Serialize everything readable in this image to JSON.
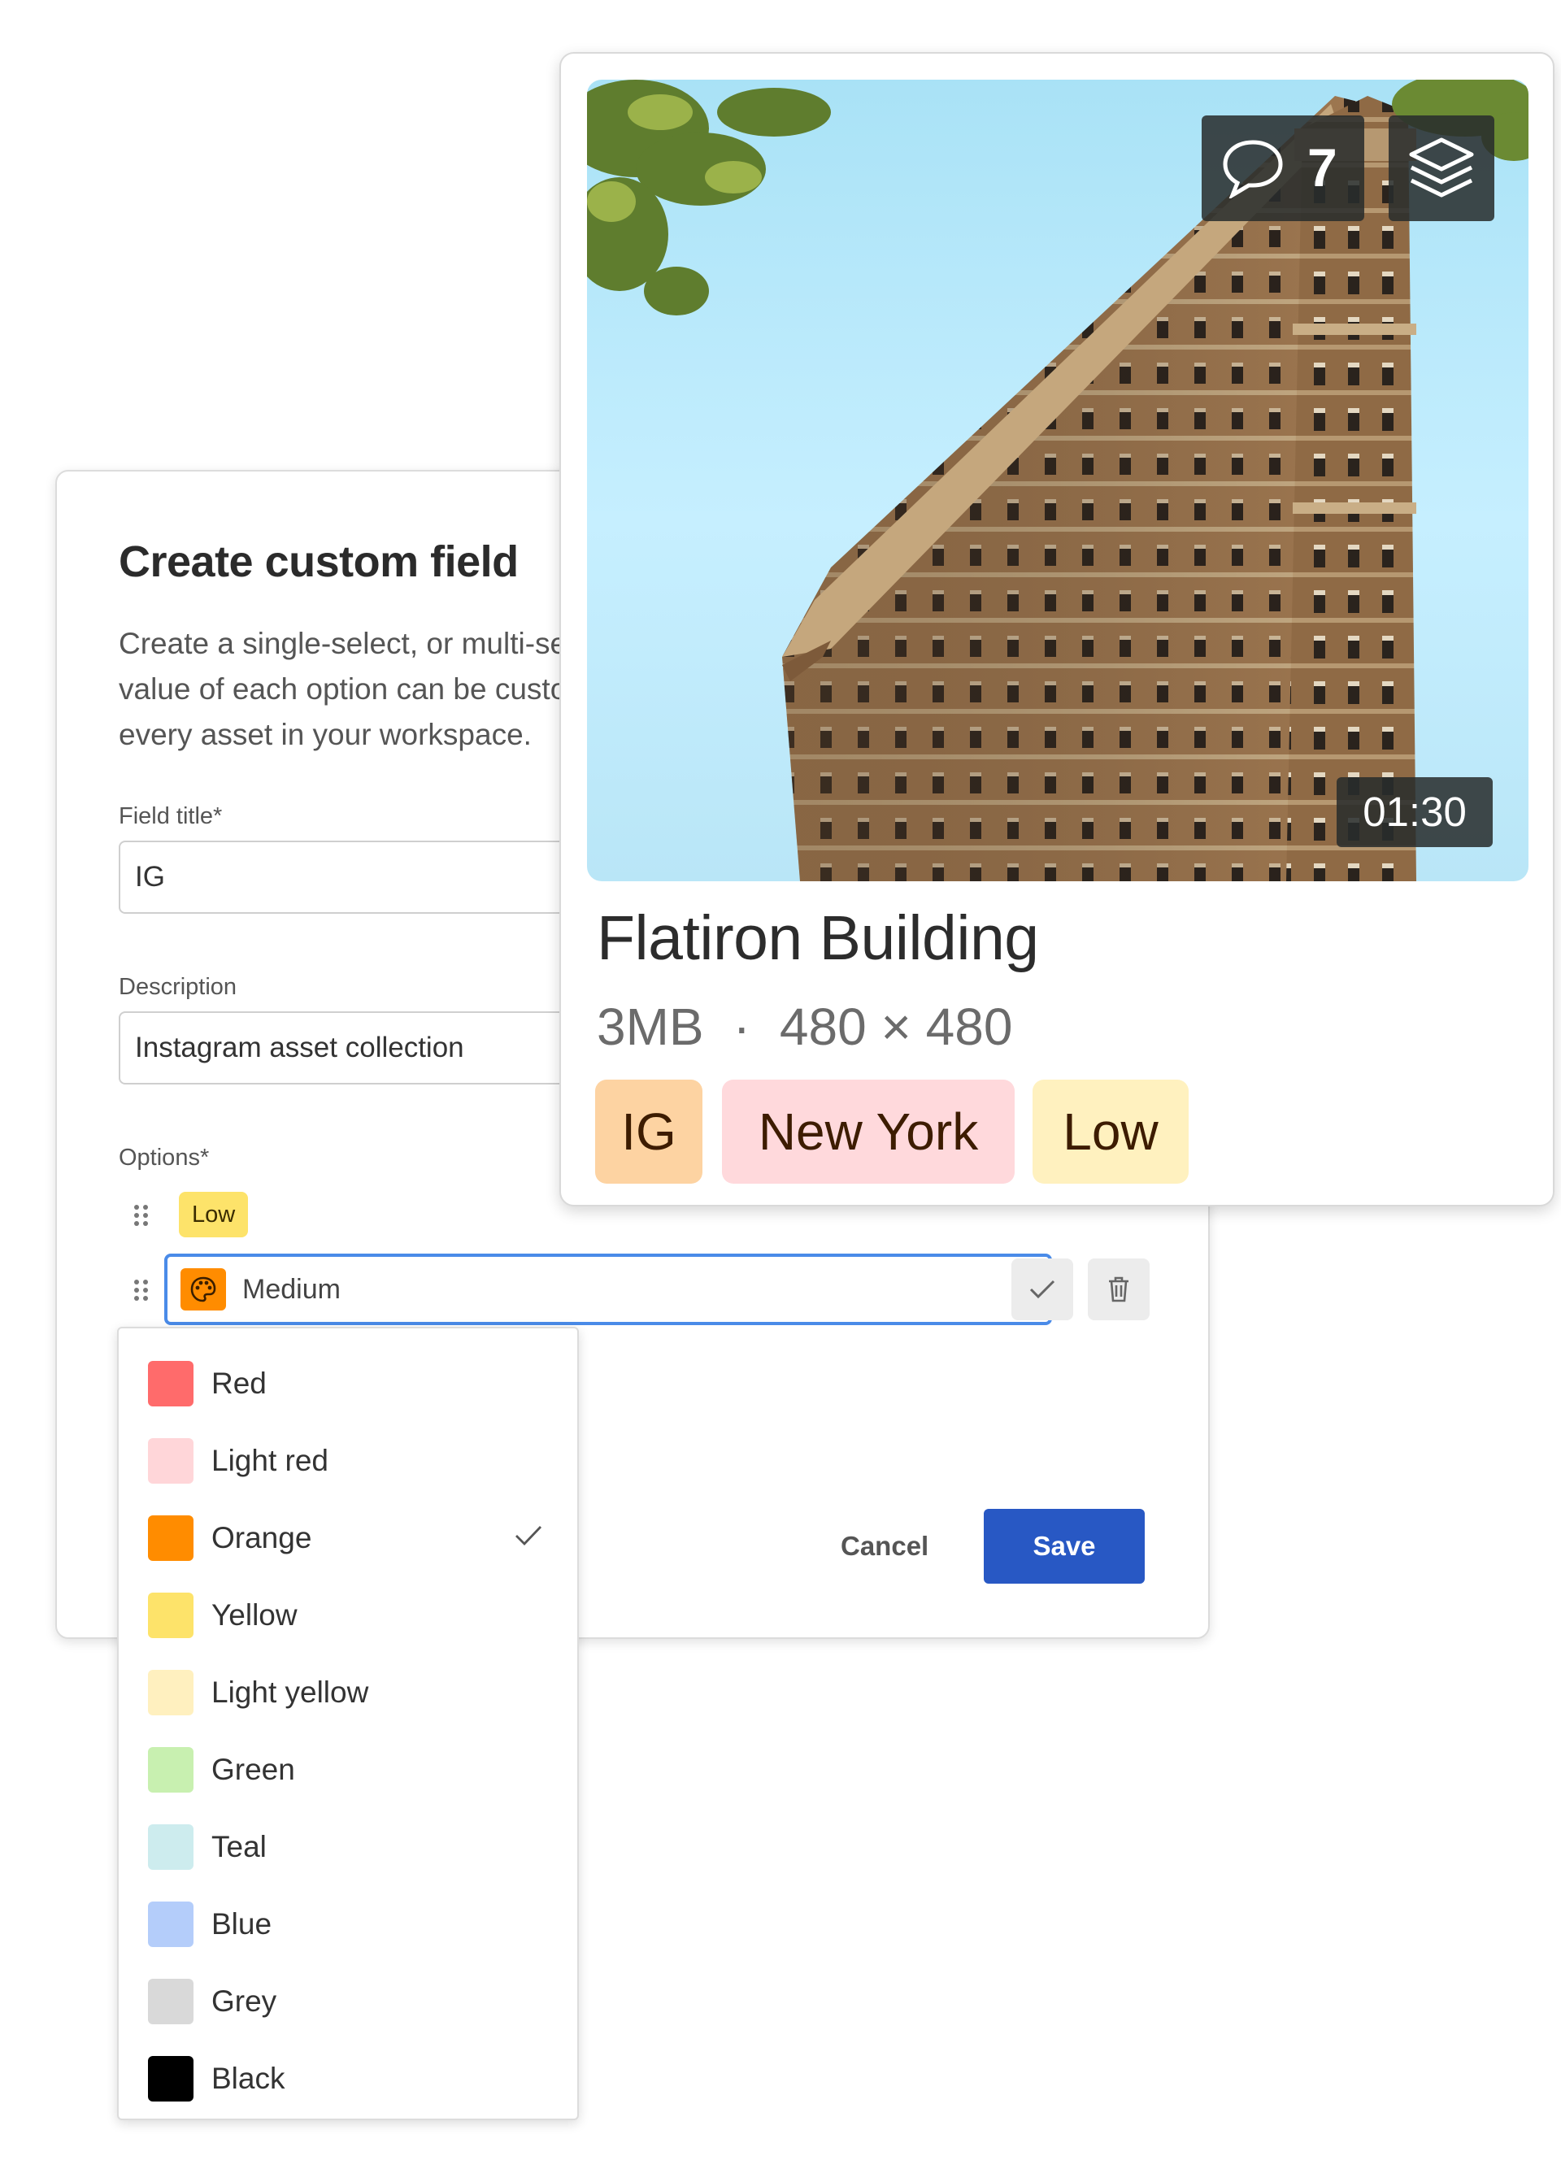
{
  "field_form": {
    "title": "Create custom field",
    "description": "Create a single-select, or multi-select custom field. The name and color value of each option can be customized. Custom fields will be available on every asset in your workspace.",
    "field_title_label": "Field title*",
    "field_title_value": "IG",
    "description_label": "Description",
    "description_value": "Instagram asset collection",
    "options_label": "Options*",
    "options": [
      {
        "label": "Low",
        "color": "#fde36a"
      },
      {
        "label": "Medium",
        "color": "#ff8c00",
        "editing": true
      }
    ],
    "cancel_label": "Cancel",
    "save_label": "Save"
  },
  "color_menu": {
    "selected": "Orange",
    "items": [
      {
        "name": "Red",
        "color": "#ff6b6b"
      },
      {
        "name": "Light red",
        "color": "#ffd6d9"
      },
      {
        "name": "Orange",
        "color": "#ff8c00"
      },
      {
        "name": "Yellow",
        "color": "#fde36a"
      },
      {
        "name": "Light yellow",
        "color": "#fff0bf"
      },
      {
        "name": "Green",
        "color": "#c8f0b0"
      },
      {
        "name": "Teal",
        "color": "#cdecee"
      },
      {
        "name": "Blue",
        "color": "#b4cdfa"
      },
      {
        "name": "Grey",
        "color": "#d9d9d9"
      },
      {
        "name": "Black",
        "color": "#000000"
      }
    ]
  },
  "asset": {
    "comments_count": "7",
    "duration": "01:30",
    "title": "Flatiron Building",
    "size": "3MB",
    "separator": "·",
    "dimensions": "480 × 480",
    "tags": [
      {
        "label": "IG",
        "color": "#fdd3a2"
      },
      {
        "label": "New York",
        "color": "#ffd9dc"
      },
      {
        "label": "Low",
        "color": "#fff1bf"
      }
    ],
    "icons": [
      "comment-icon",
      "layers-icon"
    ]
  }
}
